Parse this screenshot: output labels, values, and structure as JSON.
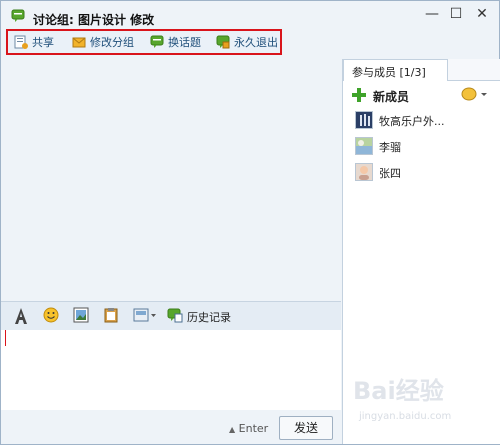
{
  "window": {
    "title": "讨论组: 图片设计 修改",
    "controls": [
      "minimize",
      "maximize",
      "close"
    ]
  },
  "toolbar": {
    "items": [
      {
        "label": "共享",
        "icon": "share-icon"
      },
      {
        "label": "修改分组",
        "icon": "edit-group-icon"
      },
      {
        "label": "换话题",
        "icon": "change-topic-icon"
      },
      {
        "label": "永久退出",
        "icon": "exit-icon"
      }
    ]
  },
  "sidebar": {
    "tab_label": "参与成员 [1/3]",
    "add_member_label": "新成员",
    "members": [
      {
        "name": "牧高乐户外..."
      },
      {
        "name": "李骝"
      },
      {
        "name": "张四"
      }
    ]
  },
  "format_bar": {
    "history_label": "历史记录"
  },
  "footer": {
    "enter_label": "Enter",
    "send_label": "发送"
  },
  "watermark": {
    "brand": "Bai经验",
    "url": "jingyan.baidu.com"
  }
}
